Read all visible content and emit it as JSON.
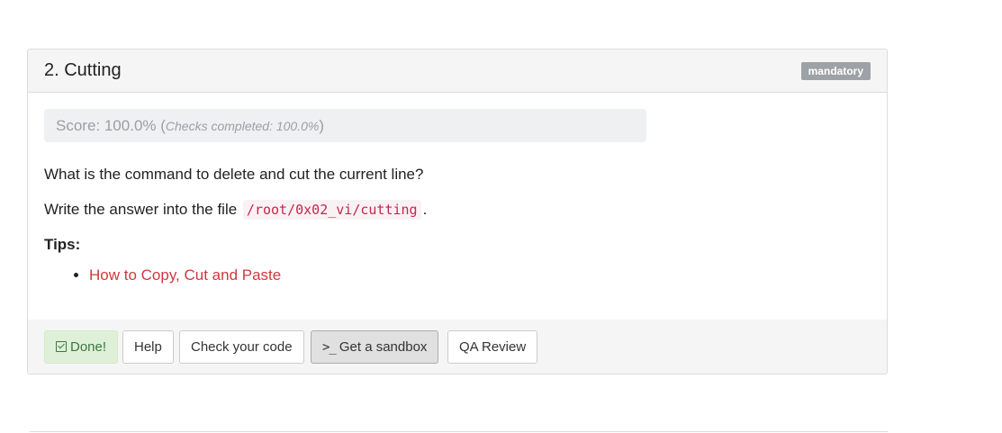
{
  "task": {
    "title": "2. Cutting",
    "badge": "mandatory",
    "score_text": "Score: 100.0% (",
    "score_detail": "Checks completed: 100.0%",
    "score_close": ")",
    "question": "What is the command to delete and cut the current line?",
    "file_prefix": "Write the answer into the file",
    "file_path": "/root/0x02_vi/cutting",
    "file_suffix": ".",
    "tips_label": "Tips:",
    "tips": [
      {
        "label": "How to Copy, Cut and Paste"
      }
    ]
  },
  "buttons": {
    "done": "Done!",
    "help": "Help",
    "check": "Check your code",
    "sandbox": "Get a sandbox",
    "qa": "QA Review"
  },
  "icons": {
    "done": "checkbox-icon",
    "sandbox": "terminal-icon"
  },
  "colors": {
    "link": "#d1383d",
    "done_bg": "#dff0d8",
    "done_text": "#3c763d",
    "badge_bg": "#9da2a8",
    "code_text": "#c7254e"
  }
}
